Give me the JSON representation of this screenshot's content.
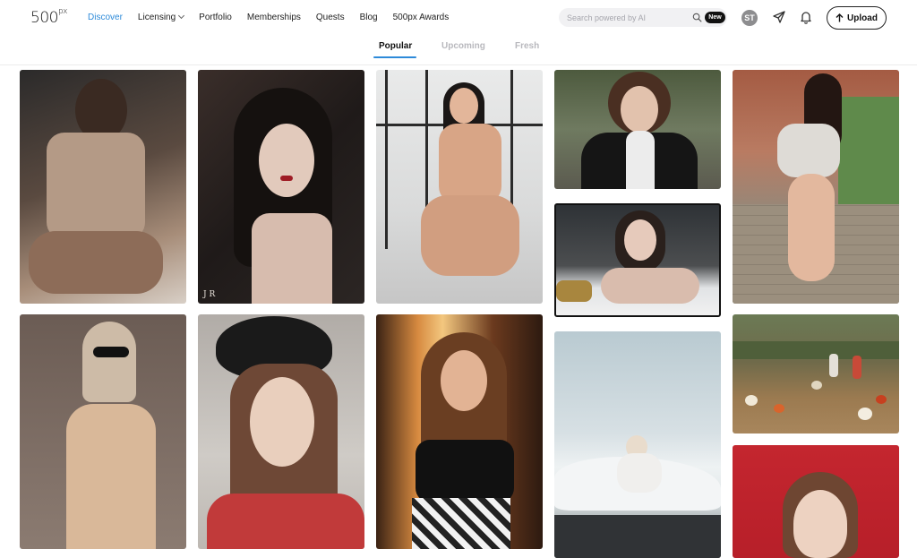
{
  "header": {
    "logo_text": "500",
    "logo_sup": "px",
    "nav": [
      {
        "label": "Discover",
        "active": true
      },
      {
        "label": "Licensing",
        "dropdown": true
      },
      {
        "label": "Portfolio"
      },
      {
        "label": "Memberships"
      },
      {
        "label": "Quests"
      },
      {
        "label": "Blog"
      },
      {
        "label": "500px Awards"
      }
    ],
    "search_placeholder": "Search powered by AI",
    "new_badge": "New",
    "avatar_initials": "ST",
    "upload_label": "Upload",
    "icons": [
      "search-icon",
      "send-icon",
      "bell-icon",
      "upload-arrow-icon"
    ]
  },
  "tabs": {
    "popular": "Popular",
    "upcoming": "Upcoming",
    "fresh": "Fresh",
    "active": "Popular"
  },
  "photos": [
    {
      "watermark": ""
    },
    {
      "watermark": "J  R"
    },
    {
      "watermark": ""
    },
    {
      "watermark": ""
    },
    {
      "watermark": ""
    },
    {
      "watermark": ""
    },
    {
      "watermark": ""
    },
    {
      "watermark": ""
    },
    {
      "watermark": ""
    },
    {
      "watermark": ""
    },
    {
      "watermark": ""
    },
    {
      "watermark": ""
    }
  ],
  "colors": {
    "accent": "#2d8ad9",
    "text": "#222222",
    "muted_tab": "#b8b8bd"
  }
}
